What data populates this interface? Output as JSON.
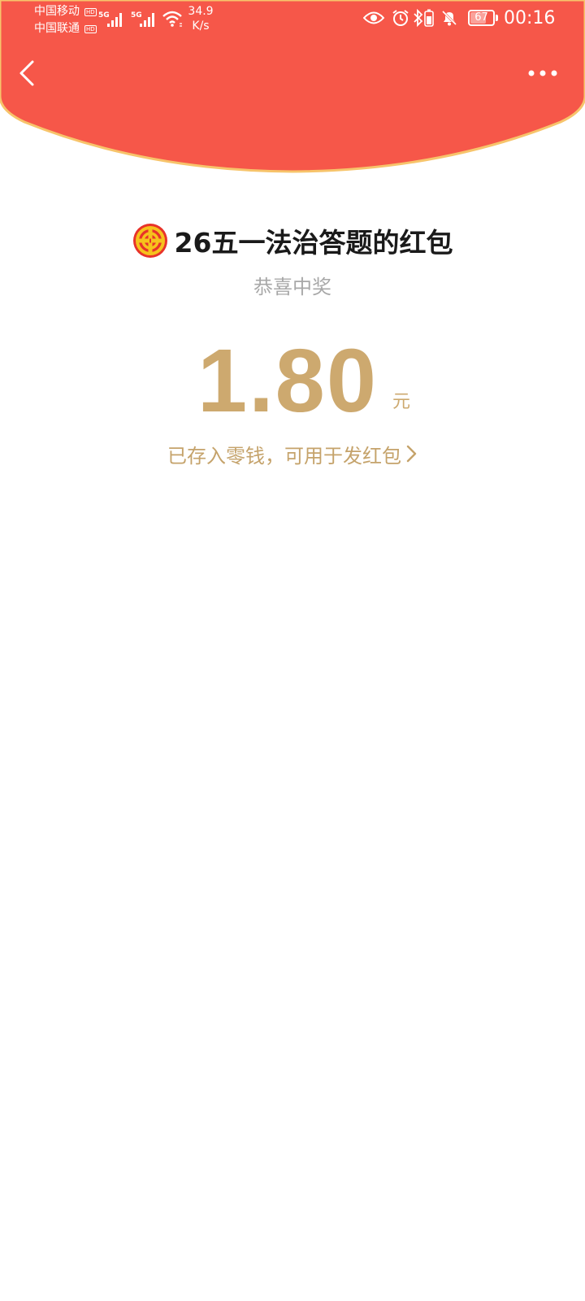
{
  "status_bar": {
    "carrier_1": "中国移动",
    "carrier_2": "中国联通",
    "hd_badge": "HD",
    "network_type": "5G",
    "net_speed_value": "34.9",
    "net_speed_unit": "K/s",
    "battery_level": "67",
    "time": "00:16",
    "icons": [
      "eye-icon",
      "alarm-icon",
      "bluetooth-icon",
      "battery-saver-icon",
      "bell-muted-icon",
      "wifi-icon",
      "signal-icon"
    ]
  },
  "nav": {
    "back_icon": "chevron-left-icon",
    "more_icon": "more-dots-icon"
  },
  "red_packet": {
    "sender_logo_icon": "union-emblem-icon",
    "title": "26五一法治答题的红包",
    "subtitle": "恭喜中奖",
    "amount": "1.80",
    "unit": "元",
    "wallet_link": "已存入零钱，可用于发红包"
  },
  "colors": {
    "header_red": "#F65749",
    "header_rim": "#F7C46B",
    "amount_gold": "#CDA96F",
    "title_text": "#1A1A1A",
    "subtitle_grey": "#A8A8A8"
  }
}
